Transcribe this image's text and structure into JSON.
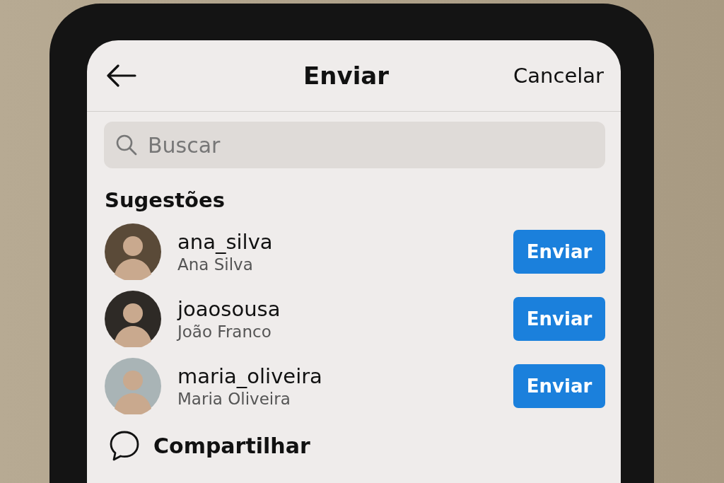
{
  "header": {
    "title": "Enviar",
    "cancel": "Cancelar"
  },
  "search": {
    "placeholder": "Buscar"
  },
  "section_title": "Sugestões",
  "contacts": [
    {
      "username": "ana_silva",
      "name": "Ana Silva",
      "button": "Enviar"
    },
    {
      "username": "joaosousa",
      "name": "João Franco",
      "button": "Enviar"
    },
    {
      "username": "maria_oliveira",
      "name": "Maria Oliveira",
      "button": "Enviar"
    }
  ],
  "share": {
    "label": "Compartilhar"
  }
}
